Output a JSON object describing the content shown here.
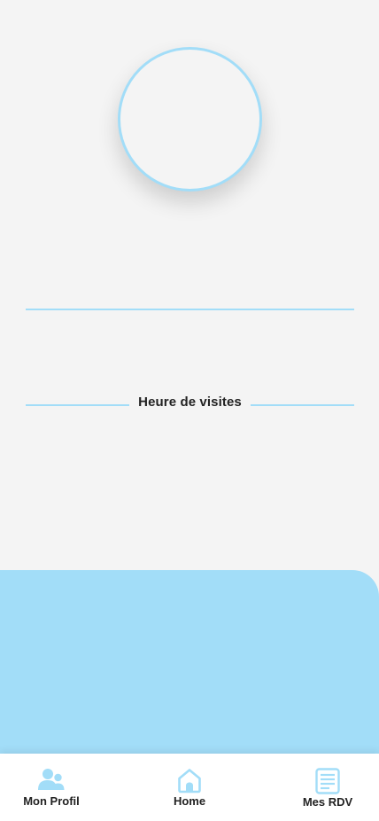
{
  "profile": {
    "avatar_icon": "empty-avatar-circle"
  },
  "visits_section": {
    "heading": "Heure de visites"
  },
  "colors": {
    "accent": "#a2ddf8",
    "background": "#f4f4f4",
    "text": "#222222",
    "nav_background": "#ffffff"
  },
  "bottom_nav": {
    "items": [
      {
        "label": "Mon Profil",
        "icon": "users-icon"
      },
      {
        "label": "Home",
        "icon": "home-icon"
      },
      {
        "label": "Mes RDV",
        "icon": "list-document-icon"
      }
    ]
  }
}
